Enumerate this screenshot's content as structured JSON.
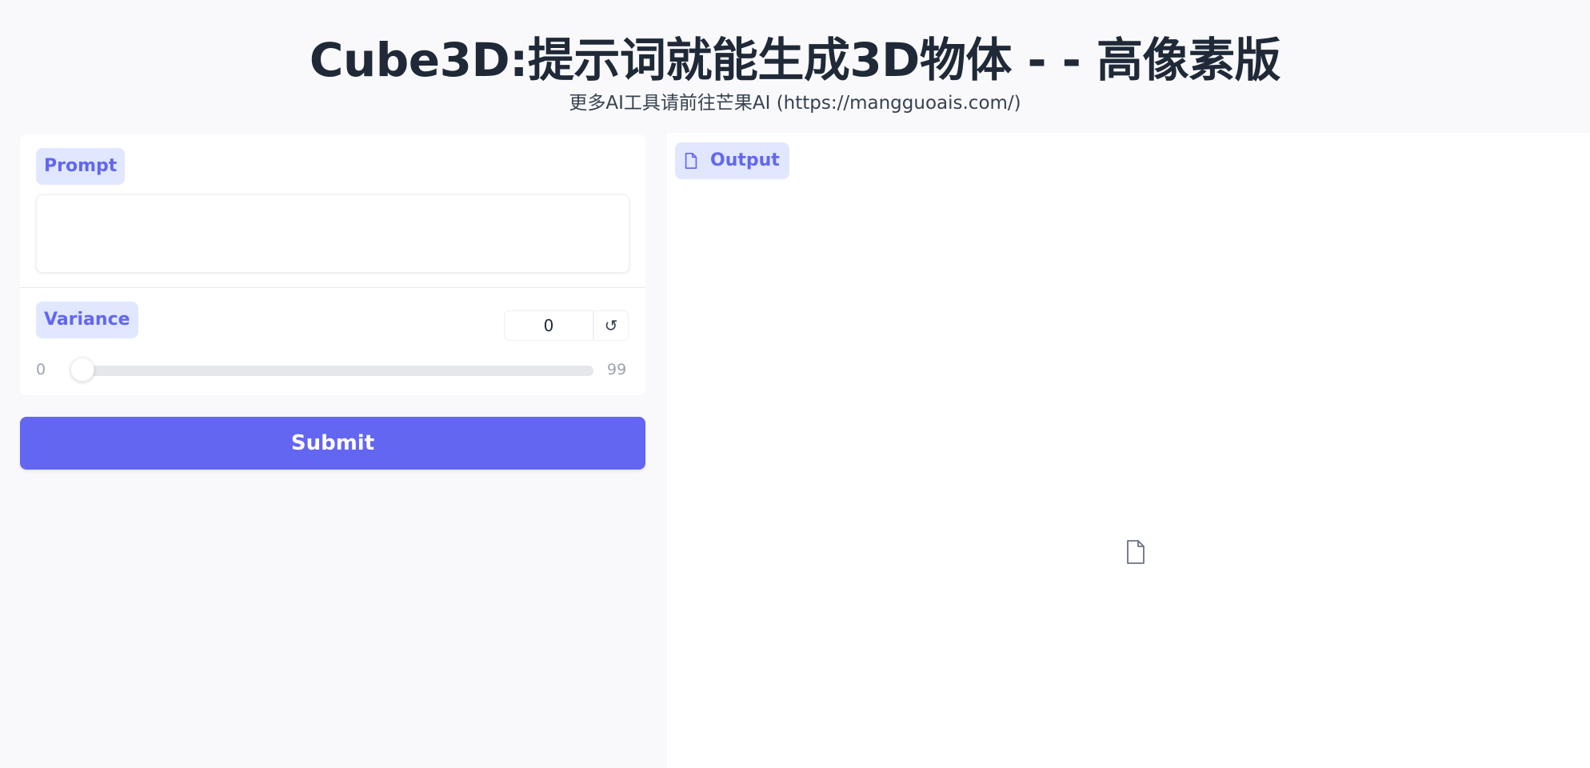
{
  "header": {
    "title": "Cube3D:提示词就能生成3D物体 -  - 高像素版",
    "subtitle": "更多AI工具请前往芒果AI (https://mangguoais.com/)"
  },
  "prompt": {
    "label": "Prompt",
    "value": "",
    "placeholder": ""
  },
  "variance": {
    "label": "Variance",
    "value": "0",
    "min": "0",
    "max": "99",
    "fraction": 0,
    "reset_icon": "↺"
  },
  "submit": {
    "label": "Submit"
  },
  "output": {
    "label": "Output",
    "label_icon": "file-icon",
    "placeholder_icon": "file-icon"
  },
  "colors": {
    "accent": "#6366f1",
    "badge_bg": "#e0e7ff"
  }
}
